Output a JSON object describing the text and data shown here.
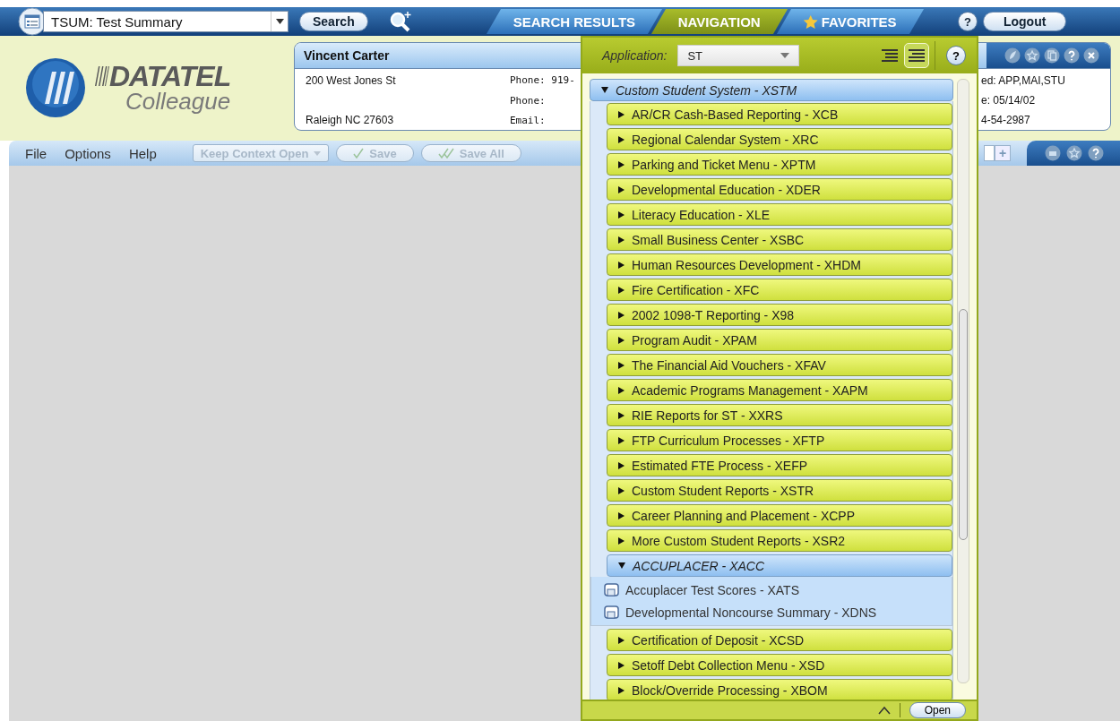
{
  "search_bar": {
    "value": "TSUM: Test Summary",
    "search_button": "Search"
  },
  "nav_tabs": [
    {
      "label": "SEARCH RESULTS",
      "kind": "plain",
      "selected": false
    },
    {
      "label": "NAVIGATION",
      "kind": "plain",
      "selected": true
    },
    {
      "label": "FAVORITES",
      "kind": "starred",
      "selected": false
    }
  ],
  "help_button": "?",
  "logout_button": "Logout",
  "logo": {
    "line1": "DATATEL",
    "line2": "Colleague"
  },
  "person_card": {
    "name": "Vincent Carter",
    "address": [
      "200 West Jones St",
      "Raleigh NC 27603"
    ],
    "contact": [
      "Phone: 919-",
      "Phone:",
      "Email:"
    ],
    "right_column": [
      "ed: APP,MAI,STU",
      "e: 05/14/02",
      "4-54-2987"
    ]
  },
  "menu": [
    "File",
    "Options",
    "Help"
  ],
  "toolbar_buttons": [
    {
      "label": "Keep Context Open",
      "kind": "dropdown",
      "disabled": true
    },
    {
      "label": "Save",
      "kind": "save",
      "disabled": true
    },
    {
      "label": "Save All",
      "kind": "save_all",
      "disabled": true
    }
  ],
  "add_button": "+",
  "navigation_panel": {
    "application_label": "Application:",
    "application_value": "ST",
    "view_toggles": [
      {
        "selected": false
      },
      {
        "selected": true
      }
    ],
    "help_button": "?",
    "tree": [
      {
        "label": "Custom Student System - XSTM",
        "kind": "folder",
        "expanded": true,
        "children": [
          {
            "label": "AR/CR Cash-Based Reporting - XCB",
            "kind": "folder",
            "expanded": false
          },
          {
            "label": "Regional Calendar System - XRC",
            "kind": "folder",
            "expanded": false
          },
          {
            "label": "Parking and Ticket Menu - XPTM",
            "kind": "folder",
            "expanded": false
          },
          {
            "label": "Developmental Education - XDER",
            "kind": "folder",
            "expanded": false
          },
          {
            "label": "Literacy Education - XLE",
            "kind": "folder",
            "expanded": false
          },
          {
            "label": "Small Business Center - XSBC",
            "kind": "folder",
            "expanded": false
          },
          {
            "label": "Human Resources Development - XHDM",
            "kind": "folder",
            "expanded": false
          },
          {
            "label": "Fire Certification - XFC",
            "kind": "folder",
            "expanded": false
          },
          {
            "label": "2002 1098-T Reporting - X98",
            "kind": "folder",
            "expanded": false
          },
          {
            "label": "Program Audit - XPAM",
            "kind": "folder",
            "expanded": false
          },
          {
            "label": "The Financial Aid Vouchers - XFAV",
            "kind": "folder",
            "expanded": false
          },
          {
            "label": "Academic Programs Management - XAPM",
            "kind": "folder",
            "expanded": false
          },
          {
            "label": "RIE Reports for ST - XXRS",
            "kind": "folder",
            "expanded": false
          },
          {
            "label": "FTP Curriculum Processes - XFTP",
            "kind": "folder",
            "expanded": false
          },
          {
            "label": "Estimated FTE Process - XEFP",
            "kind": "folder",
            "expanded": false
          },
          {
            "label": "Custom Student Reports - XSTR",
            "kind": "folder",
            "expanded": false
          },
          {
            "label": "Career Planning and Placement - XCPP",
            "kind": "folder",
            "expanded": false
          },
          {
            "label": "More Custom Student Reports - XSR2",
            "kind": "folder",
            "expanded": false
          },
          {
            "label": "ACCUPLACER - XACC",
            "kind": "folder",
            "expanded": true,
            "children": [
              {
                "label": "Accuplacer Test Scores - XATS",
                "kind": "form"
              },
              {
                "label": "Developmental Noncourse Summary - XDNS",
                "kind": "form"
              }
            ]
          },
          {
            "label": "Certification of Deposit - XCSD",
            "kind": "folder",
            "expanded": false
          },
          {
            "label": "Setoff Debt Collection Menu - XSD",
            "kind": "folder",
            "expanded": false
          },
          {
            "label": "Block/Override Processing - XBOM",
            "kind": "folder",
            "expanded": false
          }
        ]
      }
    ],
    "open_button": "Open"
  }
}
